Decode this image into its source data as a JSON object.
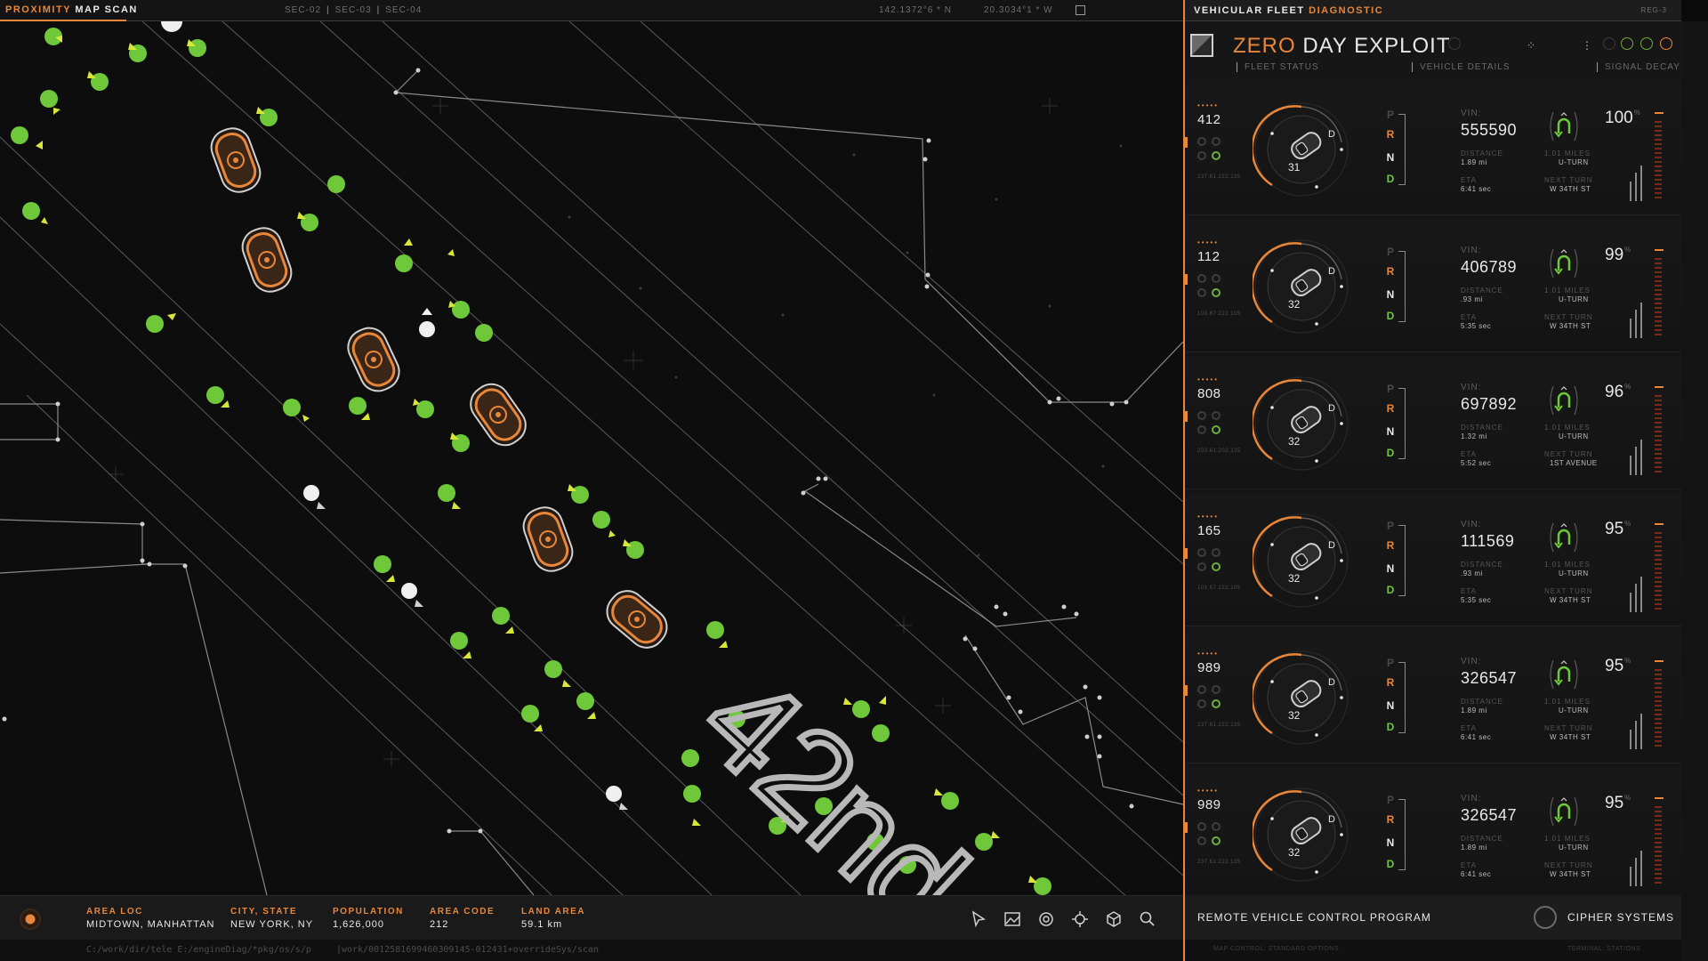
{
  "topbar": {
    "title_accent": "PROXIMITY",
    "title_rest": "MAP SCAN",
    "sectors": [
      "SEC-02",
      "SEC-03",
      "SEC-04"
    ],
    "coord_n": "142.1372°6 * N",
    "coord_w": "20.3034°1 * W"
  },
  "map": {
    "street_label": "42nd"
  },
  "bottombar": {
    "area_loc_label": "AREA LOC",
    "area_loc_value": "MIDTOWN, MANHATTAN",
    "city_label": "CITY, STATE",
    "city_value": "NEW YORK, NY",
    "population_label": "POPULATION",
    "population_value": "1,626,000",
    "area_code_label": "AREA CODE",
    "area_code_value": "212",
    "land_area_label": "LAND AREA",
    "land_area_value": "59.1 km",
    "tools": [
      "pointer-icon",
      "image-icon",
      "target-icon",
      "move-icon",
      "cube-icon",
      "search-icon"
    ],
    "path_left": "C:/work/dir/tele  E:/engineDiag/*pkg/os/s/p",
    "path_right": "|work/0012581699460309145-012431+overrideSys/scan"
  },
  "panel": {
    "title_rest": "VEHICULAR FLEET",
    "title_accent": "DIAGNOSTIC",
    "rev": "REG-3",
    "brand_accent": "ZERO",
    "brand_rest": "DAY EXPLOIT",
    "col_fleet": "FLEET STATUS",
    "col_vehicle": "VEHICLE DETAILS",
    "col_signal": "SIGNAL DECAY",
    "vin_label": "VIN:",
    "distance_label": "DISTANCE",
    "eta_label": "ETA",
    "next_turn_label": "NEXT TURN",
    "footer_left": "REMOTE VEHICLE CONTROL PROGRAM",
    "footer_right": "CIPHER SYSTEMS",
    "footer_small_left": "MAP CONTROL: STANDARD OPTIONS",
    "footer_small_right": "TERMINAL: STATIONS",
    "rows": [
      {
        "fleet_no": "412",
        "speed": "31",
        "vin": "555590",
        "distance": "1.89 mi",
        "eta": "6:41 sec",
        "upcoming": "1.01 MILES",
        "turn": "U-TURN",
        "next_turn": "W 34TH ST",
        "signal": "100",
        "ip": "237.61.222.135"
      },
      {
        "fleet_no": "112",
        "speed": "32",
        "vin": "406789",
        "distance": ".93 mi",
        "eta": "5:35 sec",
        "upcoming": "1.01 MILES",
        "turn": "U-TURN",
        "next_turn": "W 34TH ST",
        "signal": "99",
        "ip": "103.67.222.105"
      },
      {
        "fleet_no": "808",
        "speed": "32",
        "vin": "697892",
        "distance": "1.32 mi",
        "eta": "5:52 sec",
        "upcoming": "1.01 MILES",
        "turn": "U-TURN",
        "next_turn": "1ST AVENUE",
        "signal": "96",
        "ip": "203.61.202.135"
      },
      {
        "fleet_no": "165",
        "speed": "32",
        "vin": "111569",
        "distance": ".93 mi",
        "eta": "5:35 sec",
        "upcoming": "1.01 MILES",
        "turn": "U-TURN",
        "next_turn": "W 34TH ST",
        "signal": "95",
        "ip": "103.67.222.105"
      },
      {
        "fleet_no": "989",
        "speed": "32",
        "vin": "326547",
        "distance": "1.89 mi",
        "eta": "6:41 sec",
        "upcoming": "1.01 MILES",
        "turn": "U-TURN",
        "next_turn": "W 34TH ST",
        "signal": "95",
        "ip": "237.61.222.135"
      },
      {
        "fleet_no": "989",
        "speed": "32",
        "vin": "326547",
        "distance": "1.89 mi",
        "eta": "6:41 sec",
        "upcoming": "1.01 MILES",
        "turn": "U-TURN",
        "next_turn": "W 34TH ST",
        "signal": "95",
        "ip": "237.61.222.135"
      }
    ]
  },
  "colors": {
    "accent": "#e8863a",
    "green": "#6fc83a",
    "background": "#0b0b0b"
  }
}
